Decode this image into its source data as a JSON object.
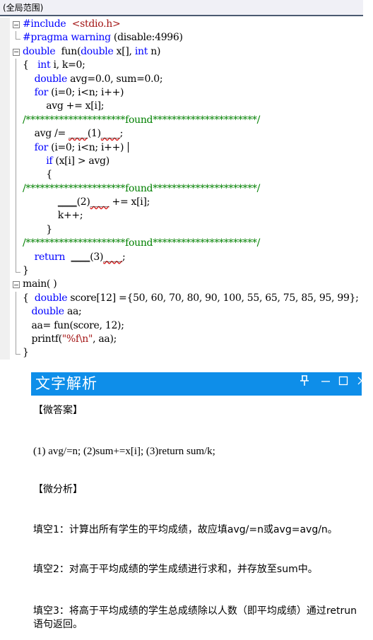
{
  "scope_bar": {
    "label": "(全局范围)"
  },
  "code": {
    "lines": [
      {
        "fold": "open",
        "parts": [
          {
            "c": "pp",
            "t": "#include"
          },
          {
            "c": "",
            "t": "  "
          },
          {
            "c": "hdr",
            "t": "<stdio.h>"
          }
        ]
      },
      {
        "fold": "guide-end",
        "parts": [
          {
            "c": "pp",
            "t": "#pragma warning"
          },
          {
            "c": "",
            "t": " (disable:4996)"
          }
        ]
      },
      {
        "fold": "open",
        "parts": [
          {
            "c": "kw",
            "t": "double"
          },
          {
            "c": "",
            "t": "  fun("
          },
          {
            "c": "kw",
            "t": "double"
          },
          {
            "c": "",
            "t": " x[], "
          },
          {
            "c": "kw",
            "t": "int"
          },
          {
            "c": "",
            "t": " n)"
          }
        ]
      },
      {
        "fold": "guide",
        "parts": [
          {
            "c": "",
            "t": "{   "
          },
          {
            "c": "kw",
            "t": "int"
          },
          {
            "c": "",
            "t": " i, k=0;"
          }
        ]
      },
      {
        "fold": "guide",
        "parts": [
          {
            "c": "",
            "t": "    "
          },
          {
            "c": "kw",
            "t": "double"
          },
          {
            "c": "",
            "t": " avg=0.0, sum=0.0;"
          }
        ]
      },
      {
        "fold": "guide",
        "parts": [
          {
            "c": "",
            "t": "    "
          },
          {
            "c": "kw",
            "t": "for"
          },
          {
            "c": "",
            "t": " (i=0; i<n; i++)"
          }
        ]
      },
      {
        "fold": "guide",
        "parts": [
          {
            "c": "",
            "t": "        avg += x[i];"
          }
        ]
      },
      {
        "fold": "guide",
        "parts": [
          {
            "c": "cm",
            "t": "/*********************found**********************/"
          }
        ]
      },
      {
        "fold": "guide",
        "parts": [
          {
            "c": "",
            "t": "    avg /= "
          },
          {
            "c": "squig",
            "t": "____"
          },
          {
            "c": "",
            "t": "(1)"
          },
          {
            "c": "squig",
            "t": "____"
          },
          {
            "c": "",
            "t": ";"
          }
        ]
      },
      {
        "fold": "guide",
        "caret": true,
        "parts": [
          {
            "c": "",
            "t": "    "
          },
          {
            "c": "kw",
            "t": "for"
          },
          {
            "c": "",
            "t": " (i=0; i<n; i++)"
          }
        ]
      },
      {
        "fold": "guide",
        "parts": [
          {
            "c": "",
            "t": "        "
          },
          {
            "c": "kw",
            "t": "if"
          },
          {
            "c": "",
            "t": " (x[i] > avg)"
          }
        ]
      },
      {
        "fold": "guide",
        "parts": [
          {
            "c": "",
            "t": "        {"
          }
        ]
      },
      {
        "fold": "guide",
        "parts": [
          {
            "c": "cm",
            "t": "/*********************found**********************/"
          }
        ]
      },
      {
        "fold": "guide",
        "parts": [
          {
            "c": "",
            "t": "            "
          },
          {
            "c": "blank",
            "t": "____"
          },
          {
            "c": "",
            "t": "(2)"
          },
          {
            "c": "squig",
            "t": "____"
          },
          {
            "c": "",
            "t": " += x[i];"
          }
        ]
      },
      {
        "fold": "guide",
        "parts": [
          {
            "c": "",
            "t": "            k++;"
          }
        ]
      },
      {
        "fold": "guide",
        "parts": [
          {
            "c": "",
            "t": "        }"
          }
        ]
      },
      {
        "fold": "guide",
        "parts": [
          {
            "c": "cm",
            "t": "/*********************found**********************/"
          }
        ]
      },
      {
        "fold": "guide",
        "parts": [
          {
            "c": "",
            "t": "    "
          },
          {
            "c": "kw",
            "t": "return"
          },
          {
            "c": "",
            "t": "  "
          },
          {
            "c": "blank",
            "t": "____"
          },
          {
            "c": "",
            "t": "(3)"
          },
          {
            "c": "squig",
            "t": "____"
          },
          {
            "c": "",
            "t": ";"
          }
        ]
      },
      {
        "fold": "guide-end",
        "parts": [
          {
            "c": "",
            "t": "}"
          }
        ]
      },
      {
        "fold": "open",
        "parts": [
          {
            "c": "",
            "t": "main( )"
          }
        ]
      },
      {
        "fold": "guide",
        "parts": [
          {
            "c": "",
            "t": "{  "
          },
          {
            "c": "kw",
            "t": "double"
          },
          {
            "c": "",
            "t": " score[12] ={50, 60, 70, 80, 90, 100, 55, 65, 75, 85, 95, 99};"
          }
        ]
      },
      {
        "fold": "guide",
        "parts": [
          {
            "c": "",
            "t": "   "
          },
          {
            "c": "kw",
            "t": "double"
          },
          {
            "c": "",
            "t": " aa;"
          }
        ]
      },
      {
        "fold": "guide",
        "parts": [
          {
            "c": "",
            "t": "   aa= fun(score, 12);"
          }
        ]
      },
      {
        "fold": "guide",
        "parts": [
          {
            "c": "",
            "t": "   printf("
          },
          {
            "c": "str",
            "t": "\"%f\\n\""
          },
          {
            "c": "",
            "t": ", aa);"
          }
        ]
      },
      {
        "fold": "guide-end",
        "parts": [
          {
            "c": "",
            "t": "}"
          }
        ]
      }
    ]
  },
  "panel": {
    "title": "文字解析",
    "controls": {
      "pin": "⊥",
      "minimize": "—",
      "maximize": "☐",
      "close": "✕"
    },
    "answer_heading": "【微答案】",
    "answer_text": "(1) avg/=n; (2)sum+=x[i]; (3)return sum/k;",
    "analysis_heading": "【微分析】",
    "blank1": "填空1：计算出所有学生的平均成绩，故应填avg/=n或avg=avg/n。",
    "blank2": "填空2：对高于平均成绩的学生成绩进行求和，并存放至sum中。",
    "blank3": "填空3：将高于平均成绩的学生总成绩除以人数（即平均成绩）通过retrun语句返回。"
  }
}
